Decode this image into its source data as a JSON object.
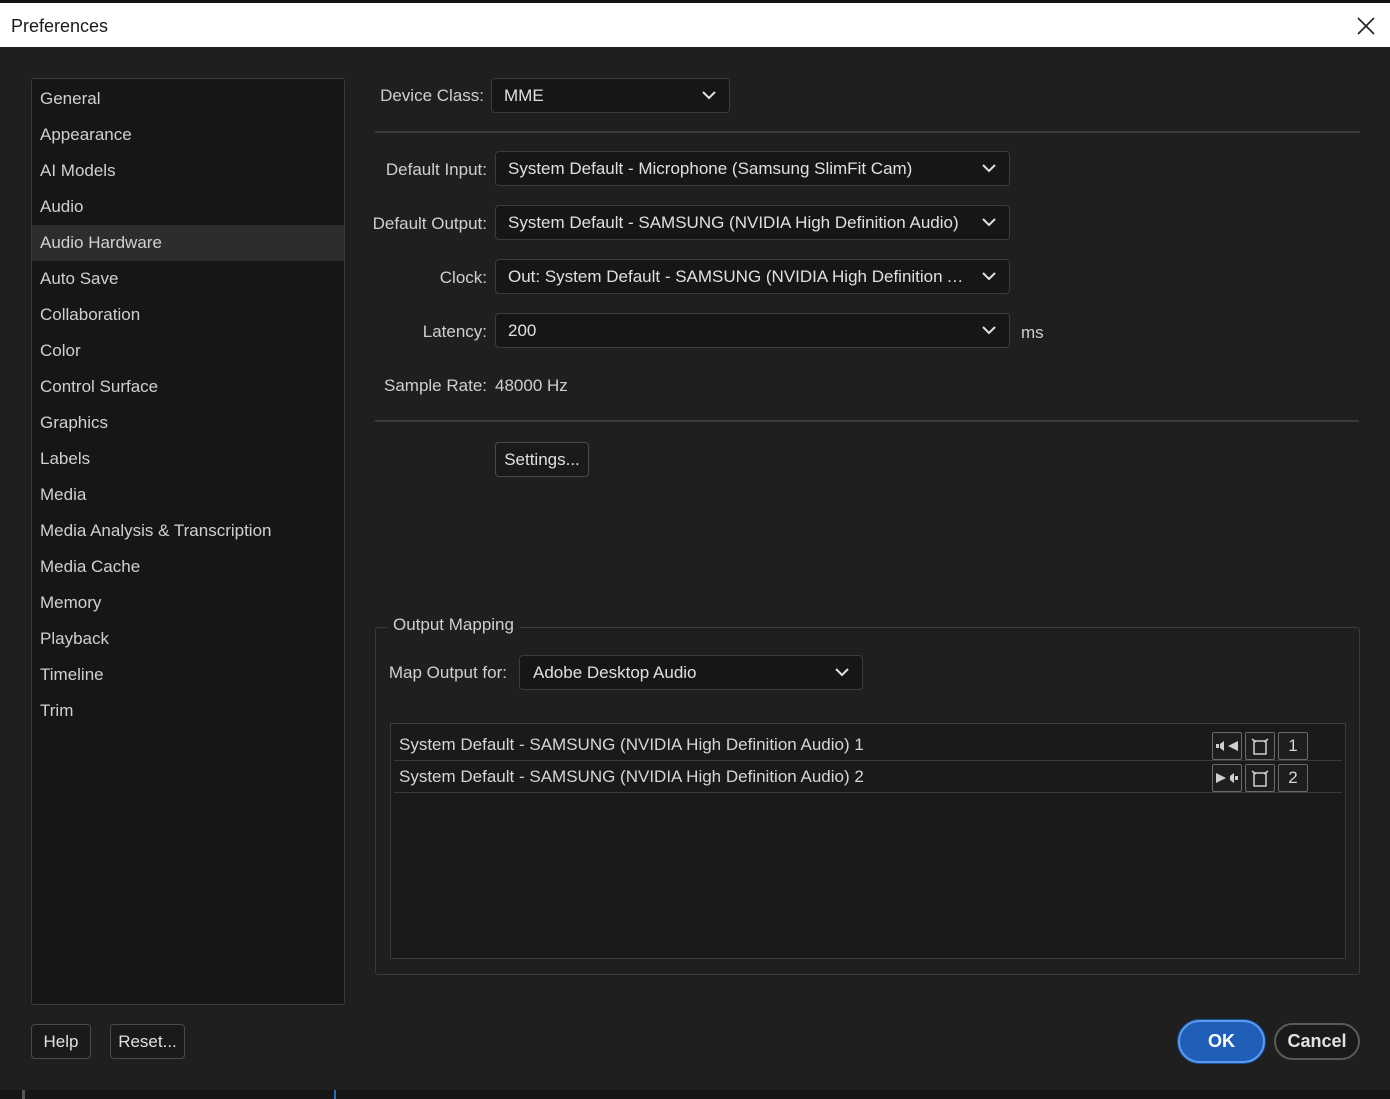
{
  "window": {
    "title": "Preferences"
  },
  "sidebar": {
    "items": [
      {
        "label": "General"
      },
      {
        "label": "Appearance"
      },
      {
        "label": "AI Models"
      },
      {
        "label": "Audio"
      },
      {
        "label": "Audio Hardware",
        "selected": true
      },
      {
        "label": "Auto Save"
      },
      {
        "label": "Collaboration"
      },
      {
        "label": "Color"
      },
      {
        "label": "Control Surface"
      },
      {
        "label": "Graphics"
      },
      {
        "label": "Labels"
      },
      {
        "label": "Media"
      },
      {
        "label": "Media Analysis & Transcription"
      },
      {
        "label": "Media Cache"
      },
      {
        "label": "Memory"
      },
      {
        "label": "Playback"
      },
      {
        "label": "Timeline"
      },
      {
        "label": "Trim"
      }
    ]
  },
  "device_class": {
    "label": "Device Class:",
    "value": "MME"
  },
  "default_input": {
    "label": "Default Input:",
    "value": "System Default - Microphone (Samsung SlimFit Cam)"
  },
  "default_output": {
    "label": "Default Output:",
    "value": "System Default - SAMSUNG (NVIDIA High Definition Audio)"
  },
  "clock": {
    "label": "Clock:",
    "value": "Out: System Default - SAMSUNG (NVIDIA High Definition Aud..."
  },
  "latency": {
    "label": "Latency:",
    "value": "200",
    "unit": "ms"
  },
  "sample_rate": {
    "label": "Sample Rate:",
    "value": "48000 Hz"
  },
  "settings_button": {
    "label": "Settings..."
  },
  "output_mapping": {
    "title": "Output Mapping",
    "map_output_label": "Map Output for:",
    "map_output_value": "Adobe Desktop Audio",
    "rows": [
      {
        "label": "System Default - SAMSUNG (NVIDIA High Definition Audio) 1",
        "channel": "1",
        "speaker_icon": "speaker-left-icon"
      },
      {
        "label": "System Default - SAMSUNG (NVIDIA High Definition Audio) 2",
        "channel": "2",
        "speaker_icon": "speaker-right-icon"
      }
    ]
  },
  "footer": {
    "help_label": "Help",
    "reset_label": "Reset...",
    "ok_label": "OK",
    "cancel_label": "Cancel"
  },
  "colors": {
    "accent": "#1f5fb8",
    "background": "#1f1f1f",
    "panel": "#161616"
  }
}
